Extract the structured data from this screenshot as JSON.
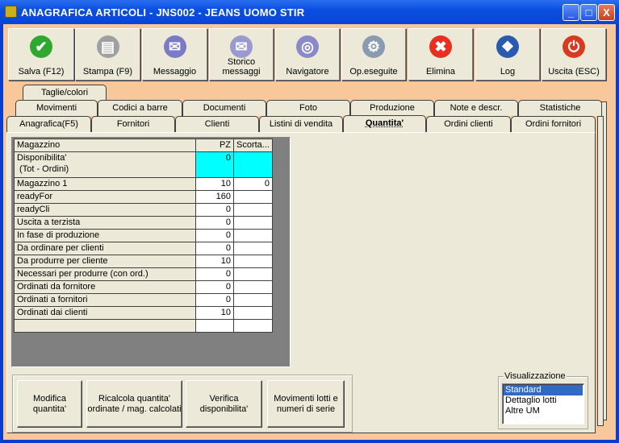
{
  "window": {
    "title": "ANAGRAFICA ARTICOLI - JNS002 - JEANS UOMO STIR",
    "minimize": "_",
    "maximize": "□",
    "close": "X"
  },
  "toolbar": [
    {
      "label": "Salva (F12)",
      "icon": "check-icon",
      "color": "#2ea82e",
      "glyph": "✔"
    },
    {
      "label": "Stampa (F9)",
      "icon": "printer-icon",
      "color": "#a0a0a0",
      "glyph": "▤"
    },
    {
      "label": "Messaggio",
      "icon": "envelope-pen-icon",
      "color": "#7a7ac8",
      "glyph": "✉"
    },
    {
      "label": "Storico messaggi",
      "icon": "envelope-search-icon",
      "color": "#9a9ad0",
      "glyph": "✉"
    },
    {
      "label": "Navigatore",
      "icon": "compass-icon",
      "color": "#8a8ac8",
      "glyph": "◎"
    },
    {
      "label": "Op.eseguite",
      "icon": "gears-search-icon",
      "color": "#8a9ab0",
      "glyph": "⚙"
    },
    {
      "label": "Elimina",
      "icon": "x-icon",
      "color": "#e83020",
      "glyph": "✖"
    },
    {
      "label": "Log",
      "icon": "book-search-icon",
      "color": "#2a5ab0",
      "glyph": "❖"
    },
    {
      "label": "Uscita (ESC)",
      "icon": "power-icon",
      "color": "#d83a20",
      "glyph": "⏻"
    }
  ],
  "tabs": {
    "row3": [
      "Taglie/colori"
    ],
    "row2": [
      "Movimenti",
      "Codici a barre",
      "Documenti",
      "Foto",
      "Produzione",
      "Note e descr.",
      "Statistiche"
    ],
    "row1": [
      "Anagrafica(F5)",
      "Fornitori",
      "Clienti",
      "Listini di vendita",
      "Quantita'",
      "Ordini clienti",
      "Ordini fornitori"
    ],
    "selected": "Quantita'"
  },
  "grid": {
    "headers": [
      "Magazzino",
      "PZ",
      "Scorta..."
    ],
    "rows": [
      {
        "label": "Disponibilita'\n (Tot - Ordini)",
        "pz": "0",
        "scorta": ""
      },
      {
        "label": "Magazzino 1",
        "pz": "10",
        "scorta": "0"
      },
      {
        "label": "readyFor",
        "pz": "160",
        "scorta": ""
      },
      {
        "label": "readyCli",
        "pz": "0",
        "scorta": ""
      },
      {
        "label": "Uscita a terzista",
        "pz": "0",
        "scorta": ""
      },
      {
        "label": "In fase di produzione",
        "pz": "0",
        "scorta": ""
      },
      {
        "label": "Da ordinare per clienti",
        "pz": "0",
        "scorta": ""
      },
      {
        "label": "Da produrre per cliente",
        "pz": "10",
        "scorta": ""
      },
      {
        "label": "Necessari per produrre (con ord.)",
        "pz": "0",
        "scorta": ""
      },
      {
        "label": "Ordinati da fornitore",
        "pz": "0",
        "scorta": ""
      },
      {
        "label": "Ordinati a fornitori",
        "pz": "0",
        "scorta": ""
      },
      {
        "label": "Ordinati dai clienti",
        "pz": "10",
        "scorta": ""
      },
      {
        "label": "",
        "pz": "",
        "scorta": ""
      }
    ]
  },
  "actions": [
    "Modifica quantita'",
    "Ricalcola quantita' ordinate / mag. calcolati",
    "Verifica disponibilita'",
    "Movimenti lotti e numeri di serie"
  ],
  "visualizzazione": {
    "label": "Visualizzazione",
    "options": [
      "Standard",
      "Dettaglio lotti",
      "Altre UM"
    ],
    "selected": "Standard"
  }
}
